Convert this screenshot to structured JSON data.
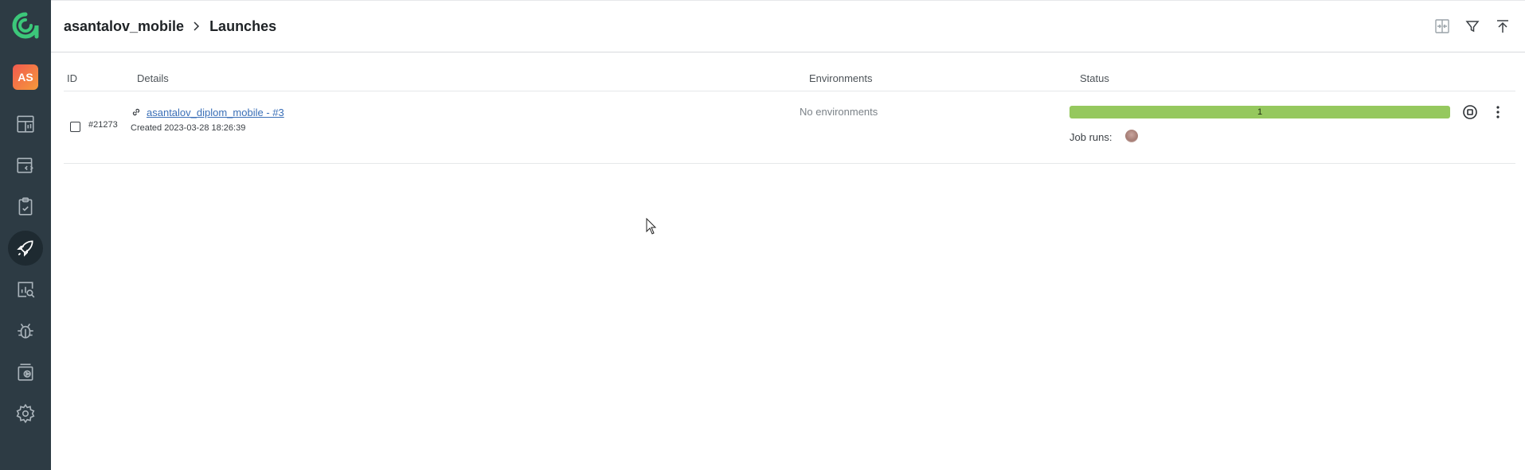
{
  "sidebar": {
    "avatar_initials": "AS",
    "items": [
      {
        "icon": "dashboard-icon"
      },
      {
        "icon": "test-cases-icon"
      },
      {
        "icon": "test-plans-icon"
      },
      {
        "icon": "launches-icon",
        "active": true
      },
      {
        "icon": "analytics-icon"
      },
      {
        "icon": "defects-icon"
      },
      {
        "icon": "jobs-icon"
      },
      {
        "icon": "settings-icon"
      }
    ],
    "colors": {
      "background": "#2d3b44",
      "logo": "#3cc77a",
      "active": "#1e2a31"
    }
  },
  "header": {
    "project": "asantalov_mobile",
    "page": "Launches",
    "actions": [
      "compare-icon",
      "filter-icon",
      "upload-icon"
    ]
  },
  "table": {
    "columns": {
      "id": "ID",
      "details": "Details",
      "environments": "Environments",
      "status": "Status"
    },
    "rows": [
      {
        "id": "#21273",
        "name": "asantalov_diplom_mobile - #3",
        "created": "Created 2023-03-28 18:26:39",
        "environments": "No environments",
        "status_count": "1",
        "status_color": "#95c85e",
        "job_runs_label": "Job runs:"
      }
    ]
  }
}
